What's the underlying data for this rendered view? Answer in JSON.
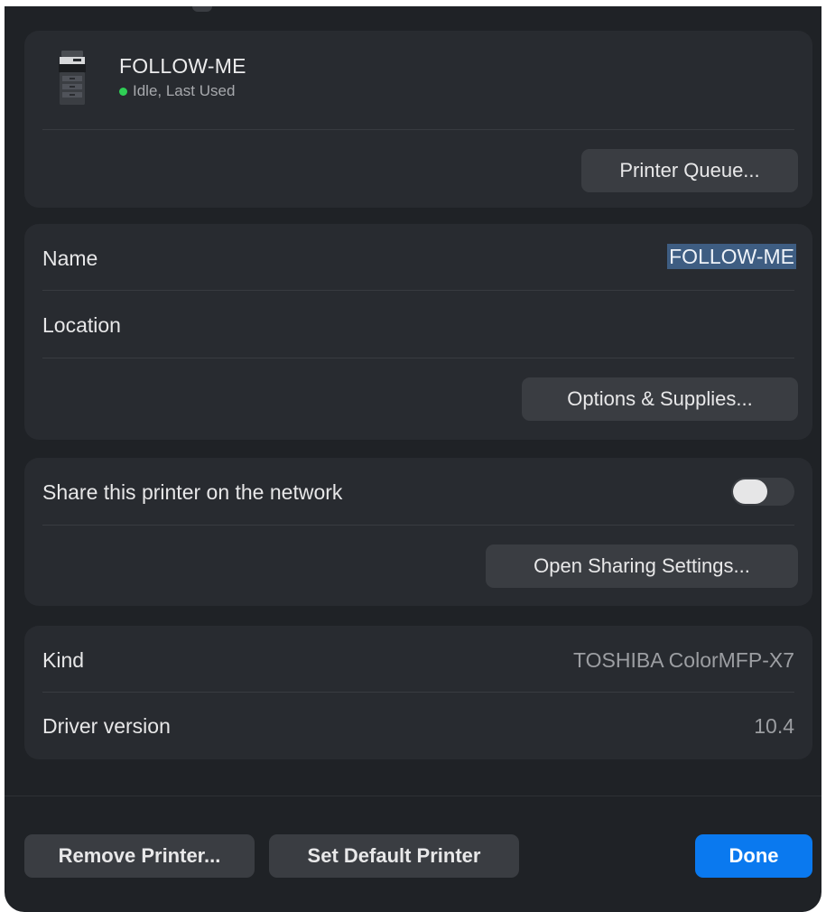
{
  "printer": {
    "name": "FOLLOW-ME",
    "status": "Idle, Last Used",
    "queue_button": "Printer Queue..."
  },
  "details": {
    "name_label": "Name",
    "name_value": "FOLLOW-ME",
    "location_label": "Location",
    "location_value": "",
    "options_button": "Options & Supplies..."
  },
  "sharing": {
    "share_label": "Share this printer on the network",
    "share_enabled": false,
    "open_settings_button": "Open Sharing Settings..."
  },
  "info": {
    "kind_label": "Kind",
    "kind_value": "TOSHIBA ColorMFP-X7",
    "driver_label": "Driver version",
    "driver_value": "10.4"
  },
  "footer": {
    "remove_button": "Remove Printer...",
    "default_button": "Set Default Printer",
    "done_button": "Done"
  },
  "colors": {
    "accent": "#0a79ef",
    "status_idle": "#2fcf55",
    "selection": "#3e5d82"
  },
  "icons": {
    "printer": "printer-icon",
    "status": "status-dot-icon"
  }
}
